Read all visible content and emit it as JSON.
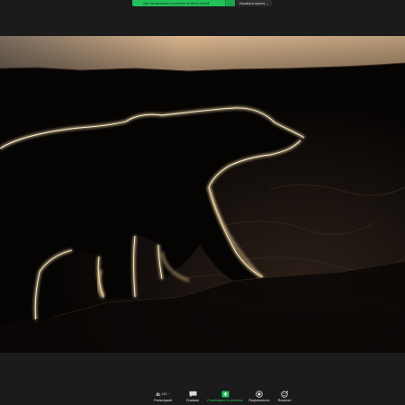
{
  "top": {
    "banner_text": "Stai visualizzando lo schermo di Marco Gentili",
    "banner_caret": "⌄",
    "view_options": "Visualizza opzioni ⌄"
  },
  "toolbar": {
    "participants": {
      "label": "Partecipanti",
      "count": "162",
      "icon": "participants-icon"
    },
    "chat": {
      "label": "Chattare",
      "icon": "chat-icon",
      "badge": ""
    },
    "share": {
      "label": "Condividere lo schermo",
      "icon": "share-screen-icon"
    },
    "record": {
      "label": "Registrazione",
      "icon": "record-icon"
    },
    "reactions": {
      "label": "Reazioni",
      "icon": "reactions-icon"
    }
  },
  "colors": {
    "share_green": "#21c25a",
    "share_label_green": "#2ec866",
    "chat_badge_red": "#e0353c",
    "rim_light": "#f4d7a0"
  }
}
